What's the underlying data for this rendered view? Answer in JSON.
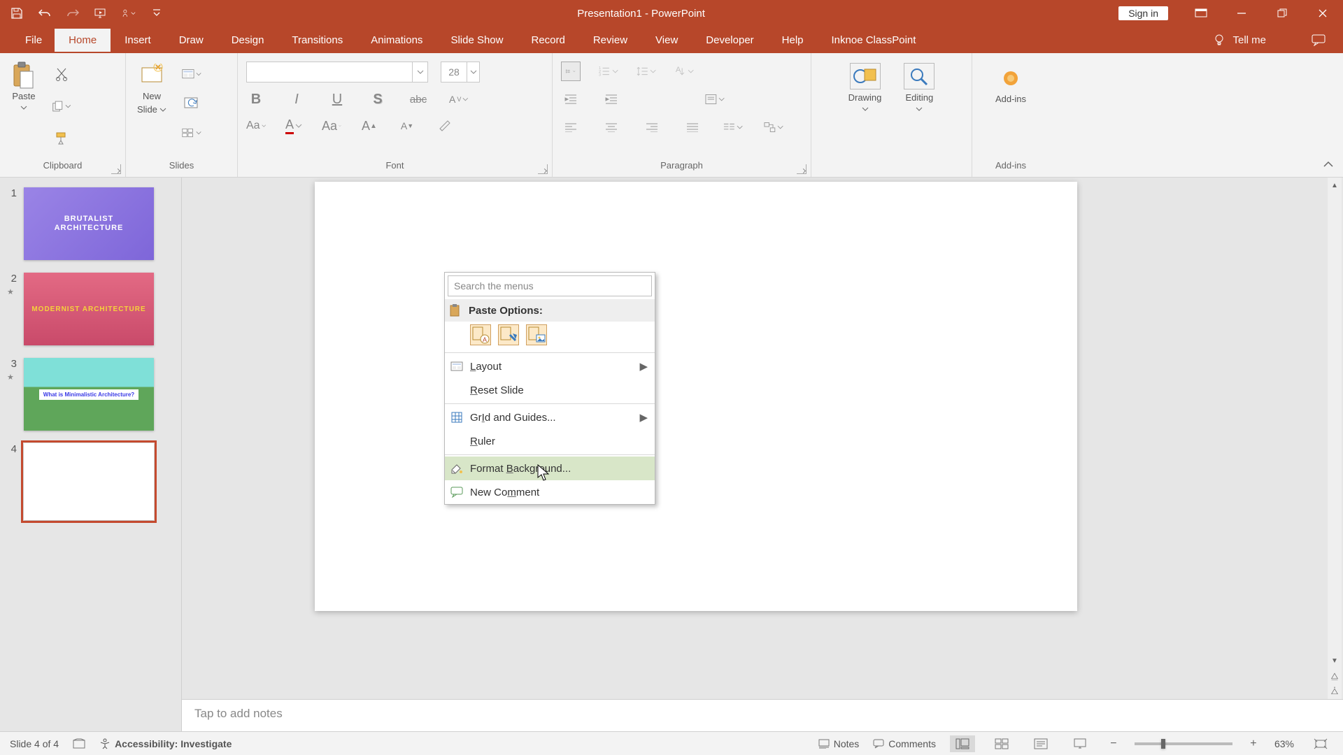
{
  "titlebar": {
    "title": "Presentation1  -  PowerPoint",
    "signin": "Sign in"
  },
  "tabs": {
    "file": "File",
    "home": "Home",
    "insert": "Insert",
    "draw": "Draw",
    "design": "Design",
    "transitions": "Transitions",
    "animations": "Animations",
    "slideshow": "Slide Show",
    "record": "Record",
    "review": "Review",
    "view": "View",
    "developer": "Developer",
    "help": "Help",
    "classpoint": "Inknoe ClassPoint",
    "tellme": "Tell me"
  },
  "ribbon": {
    "clipboard": {
      "label": "Clipboard",
      "paste": "Paste"
    },
    "slides": {
      "label": "Slides",
      "newslide_l1": "New",
      "newslide_l2": "Slide"
    },
    "font": {
      "label": "Font",
      "size": "28"
    },
    "paragraph": {
      "label": "Paragraph"
    },
    "drawing": "Drawing",
    "editing": "Editing",
    "addins": {
      "label": "Add-ins",
      "btn": "Add-ins"
    }
  },
  "thumbs": {
    "items": [
      {
        "num": "1",
        "title_l1": "BRUTALIST",
        "title_l2": "ARCHITECTURE"
      },
      {
        "num": "2",
        "title": "MODERNIST ARCHITECTURE"
      },
      {
        "num": "3",
        "title": "What is Minimalistic Architecture?"
      },
      {
        "num": "4"
      }
    ]
  },
  "context_menu": {
    "search_placeholder": "Search the menus",
    "paste_options": "Paste Options:",
    "layout": "Layout",
    "reset": "Reset Slide",
    "grid": "Grid and Guides...",
    "ruler": "Ruler",
    "format_bg": "Format Background...",
    "new_comment": "New Comment",
    "underline": {
      "layout": "L",
      "reset": "R",
      "grid": "I",
      "ruler": "R",
      "format_bg": "B",
      "new_comment": "m"
    }
  },
  "notes_placeholder": "Tap to add notes",
  "status": {
    "slide": "Slide 4 of 4",
    "accessibility": "Accessibility: Investigate",
    "notes": "Notes",
    "comments": "Comments",
    "zoom": "63%"
  }
}
